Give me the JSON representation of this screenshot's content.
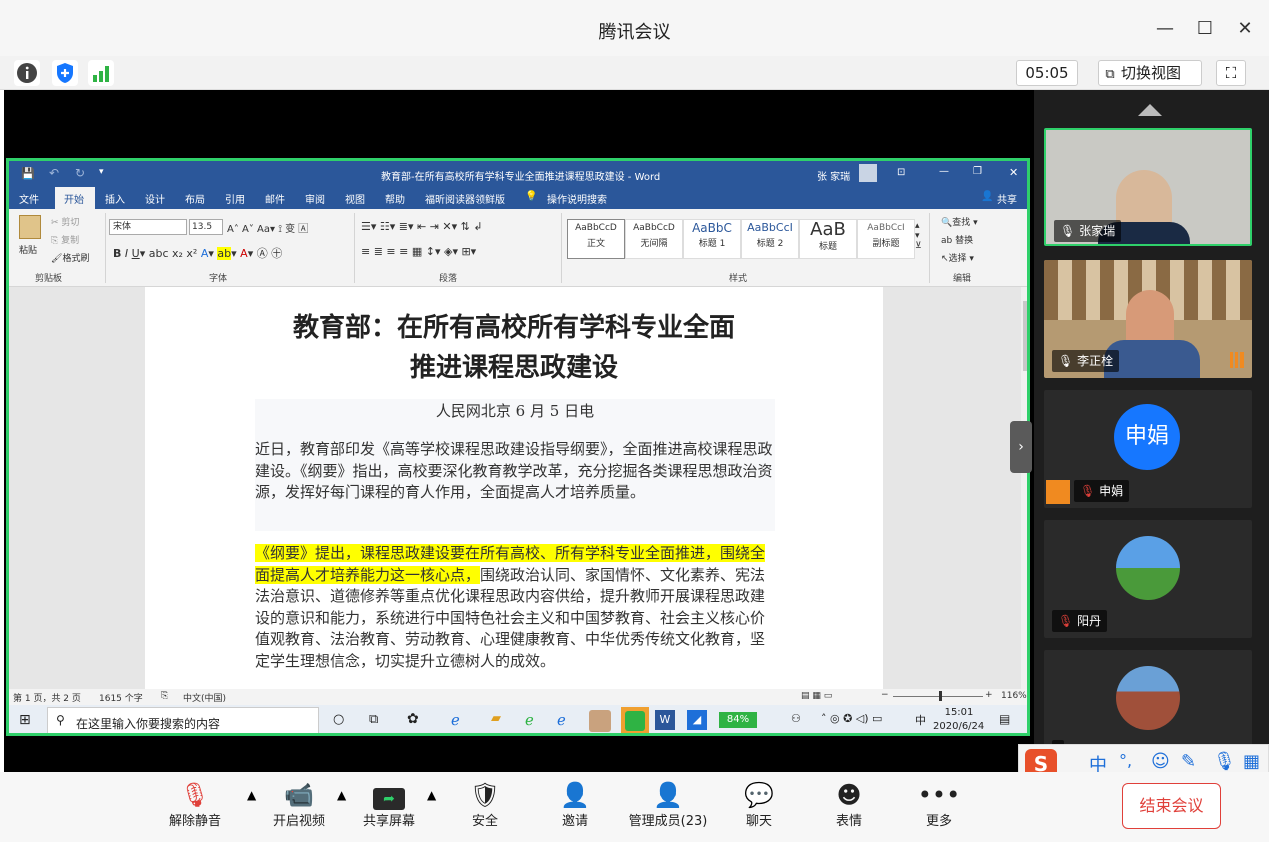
{
  "window": {
    "title": "腾讯会议",
    "minimize": "—",
    "maximize": "☐",
    "close": "✕"
  },
  "infobar": {
    "timer": "05:05",
    "switch_view": "切换视图"
  },
  "word": {
    "title": "教育部-在所有高校所有学科专业全面推进课程思政建设 - Word",
    "user": "张 家瑞",
    "tabs": [
      "文件",
      "开始",
      "插入",
      "设计",
      "布局",
      "引用",
      "邮件",
      "审阅",
      "视图",
      "帮助",
      "福昕阅读器领鲜版"
    ],
    "tell_me": "操作说明搜索",
    "share": "共享",
    "clipboard": {
      "paste": "粘贴",
      "cut": "剪切",
      "copy": "复制",
      "format_painter": "格式刷",
      "label": "剪贴板"
    },
    "font": {
      "name": "宋体",
      "size": "13.5",
      "label": "字体"
    },
    "paragraph_label": "段落",
    "styles": [
      {
        "preview": "AaBbCcD",
        "name": "正文"
      },
      {
        "preview": "AaBbCcD",
        "name": "无间隔"
      },
      {
        "preview": "AaBbC",
        "name": "标题 1"
      },
      {
        "preview": "AaBbCcI",
        "name": "标题 2"
      },
      {
        "preview": "AaB",
        "name": "标题"
      },
      {
        "preview": "AaBbCcI",
        "name": "副标题"
      }
    ],
    "styles_label": "样式",
    "editing": {
      "find": "查找",
      "replace": "替换",
      "select": "选择",
      "label": "编辑"
    },
    "doc_title_1": "教育部：在所有高校所有学科专业全面",
    "doc_title_2": "推进课程思政建设",
    "dateline": "人民网北京 6 月 5 日电",
    "para1": "近日，教育部印发《高等学校课程思政建设指导纲要》，全面推进高校课程思政建设。《纲要》指出，高校要深化教育教学改革，充分挖掘各类课程思想政治资源，发挥好每门课程的育人作用，全面提高人才培养质量。",
    "para2_hl": "《纲要》提出，课程思政建设要在所有高校、所有学科专业全面推进，围绕全面提高人才培养能力这一核心点，",
    "para2_rest": "围绕政治认同、家国情怀、文化素养、宪法法治意识、道德修养等重点优化课程思政内容供给，提升教师开展课程思政建设的意识和能力，系统进行中国特色社会主义和中国梦教育、社会主义核心价值观教育、法治教育、劳动教育、心理健康教育、中华优秀传统文化教育，坚定学生理想信念，切实提升立德树人的成效。",
    "status": {
      "page": "第 1 页，共 2 页",
      "words": "1615 个字",
      "lang": "中文(中国)",
      "zoom": "116%"
    }
  },
  "taskbar": {
    "search": "在这里输入你要搜索的内容",
    "battery": "84%",
    "time": "15:01",
    "date": "2020/6/24",
    "ime": "中"
  },
  "participants": [
    {
      "name": "张家瑞"
    },
    {
      "name": "李正栓"
    },
    {
      "name": "申娟",
      "avatar": "申娟"
    },
    {
      "name": "阳丹"
    },
    {
      "name": ""
    }
  ],
  "toolbar": [
    {
      "label": "解除静音"
    },
    {
      "label": "开启视频"
    },
    {
      "label": "共享屏幕"
    },
    {
      "label": "安全"
    },
    {
      "label": "邀请"
    },
    {
      "label": "管理成员(23)"
    },
    {
      "label": "聊天"
    },
    {
      "label": "表情"
    },
    {
      "label": "更多"
    }
  ],
  "end_meeting": "结束会议",
  "ime_bar": {
    "s": "S",
    "mode": "中",
    "punct": "°,"
  },
  "colors": {
    "word_blue": "#2b579a",
    "share_border": "#2fd06a",
    "end_red": "#e0403a",
    "avatar_blue": "#1677ff"
  }
}
